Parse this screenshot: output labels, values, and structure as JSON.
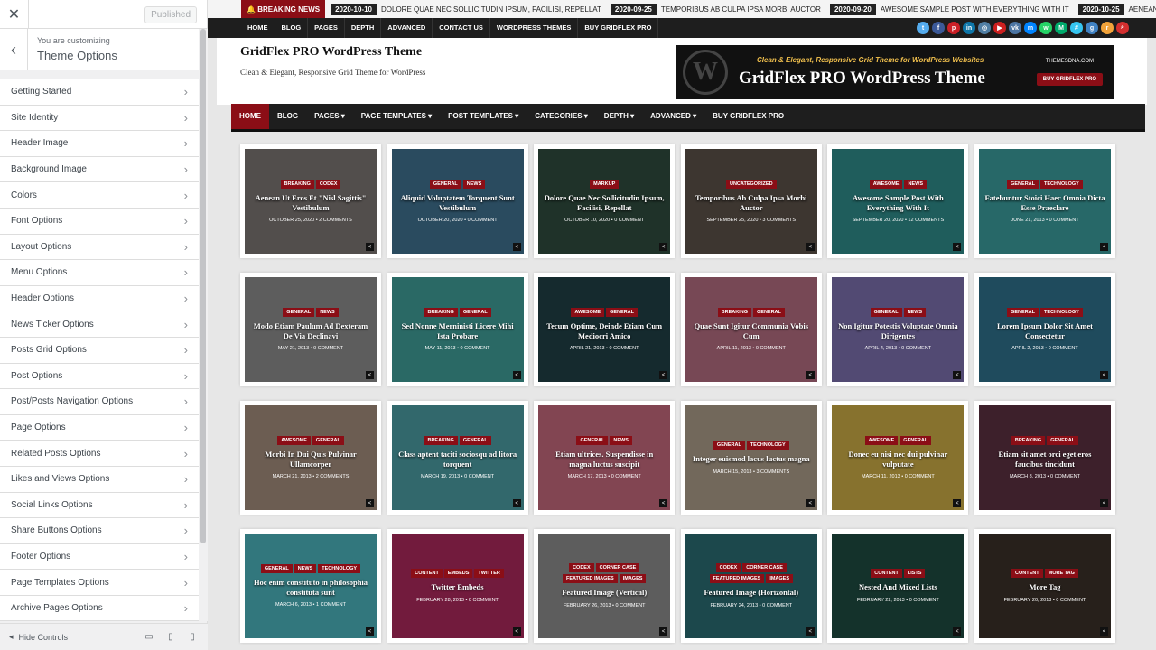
{
  "customizer": {
    "close_icon": "close-icon",
    "published_label": "Published",
    "customizing_label": "You are customizing",
    "section_title": "Theme Options",
    "hide_controls_label": "Hide Controls",
    "items": [
      {
        "label": "Getting Started"
      },
      {
        "label": "Site Identity"
      },
      {
        "label": "Header Image"
      },
      {
        "label": "Background Image"
      },
      {
        "label": "Colors"
      },
      {
        "label": "Font Options"
      },
      {
        "label": "Layout Options"
      },
      {
        "label": "Menu Options"
      },
      {
        "label": "Header Options"
      },
      {
        "label": "News Ticker Options"
      },
      {
        "label": "Posts Grid Options"
      },
      {
        "label": "Post Options"
      },
      {
        "label": "Post/Posts Navigation Options"
      },
      {
        "label": "Page Options"
      },
      {
        "label": "Related Posts Options"
      },
      {
        "label": "Likes and Views Options"
      },
      {
        "label": "Social Links Options"
      },
      {
        "label": "Share Buttons Options"
      },
      {
        "label": "Footer Options"
      },
      {
        "label": "Page Templates Options"
      },
      {
        "label": "Archive Pages Options"
      }
    ]
  },
  "ticker": {
    "label": "BREAKING NEWS",
    "items": [
      {
        "date": "2020-10-10",
        "text": "DOLORE QUAE NEC SOLLICITUDIN IPSUM, FACILISI, REPELLAT"
      },
      {
        "date": "2020-09-25",
        "text": "TEMPORIBUS AB CULPA IPSA MORBI AUCTOR"
      },
      {
        "date": "2020-09-20",
        "text": "AWESOME SAMPLE POST WITH EVERYTHING WITH IT"
      },
      {
        "date": "2020-10-25",
        "text": "AENEAN UT EROS ET \"NIS"
      }
    ]
  },
  "top_nav": [
    "HOME",
    "BLOG",
    "PAGES",
    "DEPTH",
    "ADVANCED",
    "CONTACT US",
    "WORDPRESS THEMES",
    "BUY GRIDFLEX PRO"
  ],
  "social": [
    {
      "icon": "twitter-icon",
      "glyph": "t",
      "color": "#55acee"
    },
    {
      "icon": "facebook-icon",
      "glyph": "f",
      "color": "#3b5998"
    },
    {
      "icon": "pinterest-icon",
      "glyph": "p",
      "color": "#cb2027"
    },
    {
      "icon": "linkedin-icon",
      "glyph": "in",
      "color": "#0e76a8"
    },
    {
      "icon": "instagram-icon",
      "glyph": "◎",
      "color": "#517fa4"
    },
    {
      "icon": "youtube-icon",
      "glyph": "▶",
      "color": "#cd201f"
    },
    {
      "icon": "vk-icon",
      "glyph": "vk",
      "color": "#4c75a3"
    },
    {
      "icon": "messenger-icon",
      "glyph": "m",
      "color": "#0084ff"
    },
    {
      "icon": "whatsapp-icon",
      "glyph": "w",
      "color": "#25d366"
    },
    {
      "icon": "medium-icon",
      "glyph": "M",
      "color": "#00ab6c"
    },
    {
      "icon": "slack-icon",
      "glyph": "#",
      "color": "#36c5f0"
    },
    {
      "icon": "github-icon",
      "glyph": "g",
      "color": "#4183c4"
    },
    {
      "icon": "rss-icon",
      "glyph": "r",
      "color": "#f2a33a"
    },
    {
      "icon": "search-icon",
      "glyph": "⌕",
      "color": "#d32f2f"
    }
  ],
  "header": {
    "title": "GridFlex PRO WordPress Theme",
    "description": "Clean & Elegant, Responsive Grid Theme for WordPress",
    "banner": {
      "logo": "W",
      "tagline": "Clean & Elegant, Responsive Grid Theme for WordPress Websites",
      "title": "GridFlex PRO WordPress Theme",
      "site": "THEMESDNA.COM",
      "button": "BUY GRIDFLEX PRO"
    }
  },
  "main_nav": [
    "HOME",
    "BLOG",
    "PAGES ▾",
    "PAGE TEMPLATES ▾",
    "POST TEMPLATES ▾",
    "CATEGORIES ▾",
    "DEPTH ▾",
    "ADVANCED ▾",
    "BUY GRIDFLEX PRO"
  ],
  "posts": [
    {
      "cats": [
        "BREAKING",
        "CODEX"
      ],
      "title": "Aenean Ut Eros Et \"Nisl Sagittis\" Vestibulum",
      "meta": "OCTOBER 25, 2020 • 2 COMMENTS",
      "color": "#7a7470"
    },
    {
      "cats": [
        "GENERAL",
        "NEWS"
      ],
      "title": "Aliquid Voluptatem Torquent Sunt Vestibulum",
      "meta": "OCTOBER 20, 2020 • 0 COMMENT",
      "color": "#3f6f8c"
    },
    {
      "cats": [
        "MARKUP"
      ],
      "title": "Dolore Quae Nec Sollicitudin Ipsum, Facilisi, Repellat",
      "meta": "OCTOBER 10, 2020 • 0 COMMENT",
      "color": "#2e4a3d"
    },
    {
      "cats": [
        "UNCATEGORIZED"
      ],
      "title": "Temporibus Ab Culpa Ipsa Morbi Auctor",
      "meta": "SEPTEMBER 25, 2020 • 3 COMMENTS",
      "color": "#5a5048"
    },
    {
      "cats": [
        "AWESOME",
        "NEWS"
      ],
      "title": "Awesome Sample Post With Everything With It",
      "meta": "SEPTEMBER 20, 2020 • 12 COMMENTS",
      "color": "#2f8a88"
    },
    {
      "cats": [
        "GENERAL",
        "TECHNOLOGY"
      ],
      "title": "Fatebuntur Stoici Haec Omnia Dicta Esse Praeclare",
      "meta": "JUNE 21, 2013 • 0 COMMENT",
      "color": "#3a9a9a"
    },
    {
      "cats": [
        "GENERAL",
        "NEWS"
      ],
      "title": "Modo Etiam Paulum Ad Dexteram De Via Declinavi",
      "meta": "MAY 21, 2013 • 0 COMMENT",
      "color": "#8a8a8a"
    },
    {
      "cats": [
        "BREAKING",
        "GENERAL"
      ],
      "title": "Sed Nonne Merninisti Licere Mihi Ista Probare",
      "meta": "MAY 11, 2013 • 0 COMMENT",
      "color": "#3e9b95"
    },
    {
      "cats": [
        "AWESOME",
        "GENERAL"
      ],
      "title": "Tecum Optime, Deinde Etiam Cum Mediocri Amico",
      "meta": "APRIL 21, 2013 • 0 COMMENT",
      "color": "#1f3f45"
    },
    {
      "cats": [
        "BREAKING",
        "GENERAL"
      ],
      "title": "Quae Sunt Igitur Communia Vobis Cum",
      "meta": "APRIL 11, 2013 • 0 COMMENT",
      "color": "#b06a7e"
    },
    {
      "cats": [
        "GENERAL",
        "NEWS"
      ],
      "title": "Non Igitur Potestis Voluptate Omnia Dirigentes",
      "meta": "APRIL 4, 2013 • 0 COMMENT",
      "color": "#7a6eaa"
    },
    {
      "cats": [
        "GENERAL",
        "TECHNOLOGY"
      ],
      "title": "Lorem Ipsum Dolor Sit Amet Consectetur",
      "meta": "APRIL 2, 2013 • 0 COMMENT",
      "color": "#2e6f8a"
    },
    {
      "cats": [
        "AWESOME",
        "GENERAL"
      ],
      "title": "Morbi In Dui Quis Pulvinar Ullamcorper",
      "meta": "MARCH 21, 2013 • 2 COMMENTS",
      "color": "#a08a7a"
    },
    {
      "cats": [
        "BREAKING",
        "GENERAL"
      ],
      "title": "Class aptent taciti sociosqu ad litora torquent",
      "meta": "MARCH 19, 2013 • 0 COMMENT",
      "color": "#4a9aa0"
    },
    {
      "cats": [
        "GENERAL",
        "NEWS"
      ],
      "title": "Etiam ultrices. Suspendisse in magna luctus suscipit",
      "meta": "MARCH 17, 2013 • 0 COMMENT",
      "color": "#c0667a"
    },
    {
      "cats": [
        "GENERAL",
        "TECHNOLOGY"
      ],
      "title": "Integer euismod lacus luctus magna",
      "meta": "MARCH 15, 2013 • 3 COMMENTS",
      "color": "#a89a86"
    },
    {
      "cats": [
        "AWESOME",
        "GENERAL"
      ],
      "title": "Donec eu nisi nec dui pulvinar vulputate",
      "meta": "MARCH 11, 2013 • 0 COMMENT",
      "color": "#c8a845"
    },
    {
      "cats": [
        "BREAKING",
        "GENERAL"
      ],
      "title": "Etiam sit amet orci eget eros faucibus tincidunt",
      "meta": "MARCH 8, 2013 • 0 COMMENT",
      "color": "#5a3040"
    },
    {
      "cats": [
        "GENERAL",
        "NEWS",
        "TECHNOLOGY"
      ],
      "title": "Hoc enim constituto in philosophia constituta sunt",
      "meta": "MARCH 6, 2013 • 1 COMMENT",
      "color": "#4ab0b8"
    },
    {
      "cats": [
        "CONTENT",
        "EMBEDS",
        "TWITTER"
      ],
      "title": "Twitter Embeds",
      "meta": "FEBRUARY 28, 2013 • 0 COMMENT",
      "color": "#a8285a"
    },
    {
      "cats": [
        "CODEX",
        "CORNER CASE",
        "FEATURED IMAGES",
        "IMAGES"
      ],
      "title": "Featured Image (Vertical)",
      "meta": "FEBRUARY 26, 2013 • 0 COMMENT",
      "color": "#8a8a8a"
    },
    {
      "cats": [
        "CODEX",
        "CORNER CASE",
        "FEATURED IMAGES",
        "IMAGES"
      ],
      "title": "Featured Image (Horizontal)",
      "meta": "FEBRUARY 24, 2013 • 0 COMMENT",
      "color": "#2a6a70"
    },
    {
      "cats": [
        "CONTENT",
        "LISTS"
      ],
      "title": "Nested And Mixed Lists",
      "meta": "FEBRUARY 22, 2013 • 0 COMMENT",
      "color": "#1e4a40"
    },
    {
      "cats": [
        "CONTENT",
        "MORE TAG"
      ],
      "title": "More Tag",
      "meta": "FEBRUARY 20, 2013 • 0 COMMENT",
      "color": "#3a3028"
    }
  ],
  "colors": {
    "accent": "#8b0e16",
    "dark": "#1e1e1e"
  }
}
